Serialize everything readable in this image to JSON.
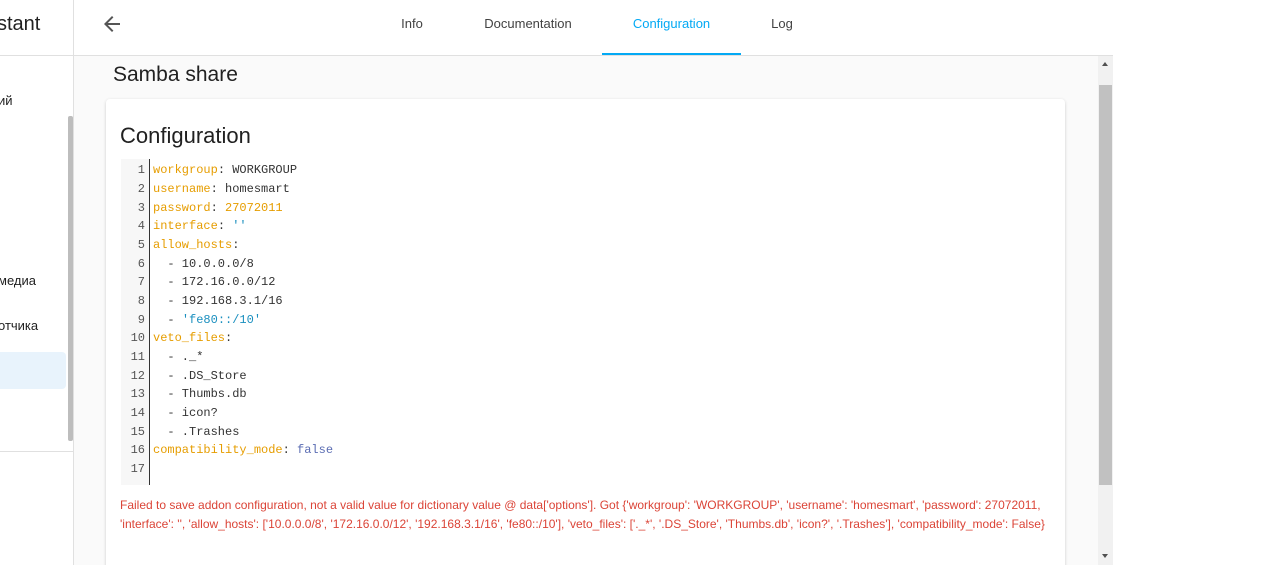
{
  "sidebar": {
    "title": "stant",
    "items": [
      {
        "label": "ий"
      },
      {
        "label": "медиа"
      },
      {
        "label": "отчика"
      }
    ]
  },
  "header": {
    "tabs": [
      {
        "label": "Info"
      },
      {
        "label": "Documentation"
      },
      {
        "label": "Configuration"
      },
      {
        "label": "Log"
      }
    ],
    "active_tab": "Configuration"
  },
  "page": {
    "title": "Samba share"
  },
  "config_card": {
    "title": "Configuration",
    "line_numbers": [
      "1",
      "2",
      "3",
      "4",
      "5",
      "6",
      "7",
      "8",
      "9",
      "10",
      "11",
      "12",
      "13",
      "14",
      "15",
      "16",
      "17"
    ],
    "lines": [
      {
        "key": "workgroup",
        "sep": ": ",
        "value": "WORKGROUP"
      },
      {
        "key": "username",
        "sep": ": ",
        "value": "homesmart"
      },
      {
        "key": "password",
        "sep": ": ",
        "value": "27072011"
      },
      {
        "key": "interface",
        "sep": ": ",
        "value": "''"
      },
      {
        "key": "allow_hosts",
        "sep": ":",
        "value": ""
      },
      {
        "item": "  - 10.0.0.0/8"
      },
      {
        "item": "  - 172.16.0.0/12"
      },
      {
        "item": "  - 192.168.3.1/16"
      },
      {
        "prefix": "  - ",
        "value": "'fe80::/10'"
      },
      {
        "key": "veto_files",
        "sep": ":",
        "value": ""
      },
      {
        "item": "  - ._*"
      },
      {
        "item": "  - .DS_Store"
      },
      {
        "item": "  - Thumbs.db"
      },
      {
        "item": "  - icon?"
      },
      {
        "item": "  - .Trashes"
      },
      {
        "key": "compatibility_mode",
        "sep": ": ",
        "value": "false"
      },
      {
        "item": ""
      }
    ],
    "error": "Failed to save addon configuration, not a valid value for dictionary value @ data['options']. Got {'workgroup': 'WORKGROUP', 'username': 'homesmart', 'password': 27072011, 'interface': '', 'allow_hosts': ['10.0.0.0/8', '172.16.0.0/12', '192.168.3.1/16', 'fe80::/10'], 'veto_files': ['._*', '.DS_Store', 'Thumbs.db', 'icon?', '.Trashes'], 'compatibility_mode': False}"
  },
  "colors": {
    "accent": "#03a9f4",
    "error": "#db4437",
    "yaml_key": "#e69d00",
    "yaml_string": "#1a8fbf",
    "yaml_bool": "#5b6db3"
  }
}
